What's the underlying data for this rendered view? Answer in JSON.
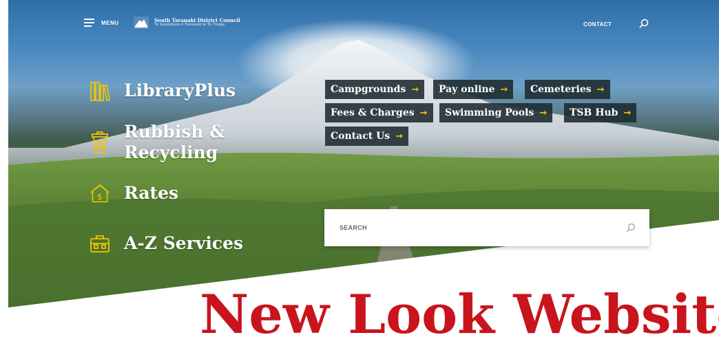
{
  "nav": {
    "menu_label": "MENU",
    "logo_title": "South Taranaki District Council",
    "logo_subtitle": "Te Kaunihera ō Taranaki ki Te Tonga",
    "contact_label": "CONTACT",
    "search_icon": "search-icon"
  },
  "services": [
    {
      "label": "LibraryPlus",
      "icon": "books-icon"
    },
    {
      "label": "Rubbish &",
      "label2": "Recycling",
      "icon": "bin-icon"
    },
    {
      "label": "Rates",
      "icon": "house-dollar-icon"
    },
    {
      "label": "A-Z Services",
      "icon": "briefcase-icon"
    }
  ],
  "quick_links": [
    {
      "label": "Campgrounds"
    },
    {
      "label": "Pay online"
    },
    {
      "label": "Cemeteries"
    },
    {
      "label": "Fees & Charges"
    },
    {
      "label": "Swimming Pools"
    },
    {
      "label": "TSB Hub"
    },
    {
      "label": "Contact Us"
    }
  ],
  "arrow_glyph": "→",
  "search": {
    "placeholder": "SEARCH"
  },
  "headline": "New Look Website",
  "colors": {
    "accent": "#f2c400",
    "tag_bg": "#1e2a30",
    "headline": "#c8141c"
  }
}
